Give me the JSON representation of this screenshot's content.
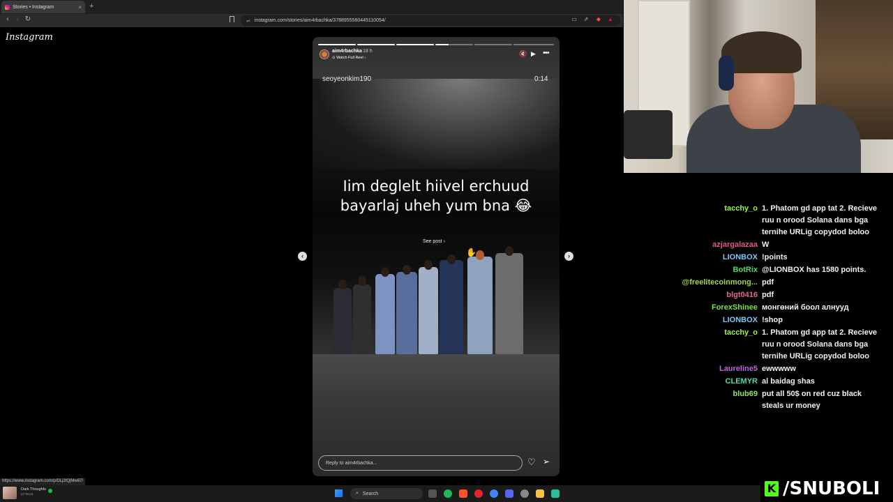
{
  "browser": {
    "tab_title": "Stories • Instagram",
    "tab_close": "×",
    "new_tab": "+",
    "url": "instagram.com/stories/aim4rbachka/3788955560445110054/",
    "status_url": "https://www.instagram.com/p/DLj2tQjMw87/"
  },
  "instagram": {
    "logo": "Instagram",
    "story": {
      "username": "aim4rbachka",
      "time_ago": "18 h",
      "watch_full_reel": "Watch Full Reel",
      "creator_tag": "seoyeonkim190",
      "duration": "0:14",
      "caption_line1": "Iim deglelt hiivel erchuud",
      "caption_line2": "bayarlaj uheh yum bna 😂",
      "see_post": "See post",
      "reply_placeholder": "Reply to aim4rbachka...",
      "progress_segments": 6,
      "progress_done": 3,
      "progress_current_fraction": 0.35
    }
  },
  "chat": {
    "messages": [
      {
        "user": "tacchy_o",
        "color": "#9bf542",
        "text": "1. Phatom gd app tat 2. Recieve ruu n orood Solana dans bga ternihe URLig copydod boloo"
      },
      {
        "user": "azjargalazaa",
        "color": "#e05b84",
        "text": "W"
      },
      {
        "user": "LIONBOX",
        "color": "#7ec8f5",
        "text": "!points"
      },
      {
        "user": "BotRix",
        "color": "#56d86b",
        "text": "@LIONBOX has 1580 points."
      },
      {
        "user": "@freelitecoinmong...",
        "color": "#a3d64a",
        "text": "pdf"
      },
      {
        "user": "blgt0416",
        "color": "#e06a8c",
        "text": "pdf"
      },
      {
        "user": "ForexShinee",
        "color": "#7be34a",
        "text": "монгөний боол алнууд"
      },
      {
        "user": "LIONBOX",
        "color": "#7ec8f5",
        "text": "!shop"
      },
      {
        "user": "tacchy_o",
        "color": "#9bf542",
        "text": "1. Phatom gd app tat 2. Recieve ruu n orood Solana dans bga ternihe URLig copydod boloo"
      },
      {
        "user": "Laureline5",
        "color": "#b86be0",
        "text": "ewwwww"
      },
      {
        "user": "CLEMYR",
        "color": "#4fd9b2",
        "text": "al baidag shas"
      },
      {
        "user": "blub69",
        "color": "#8fe36a",
        "text": "put all 50$ on red cuz black steals ur money"
      }
    ]
  },
  "overlay": {
    "brand": "/SNUBOLI",
    "brand_color": "#53fc18"
  },
  "taskbar": {
    "now_playing_title": "Dark Thoughts",
    "now_playing_artist": "Lil Tecca",
    "search_label": "Search"
  }
}
